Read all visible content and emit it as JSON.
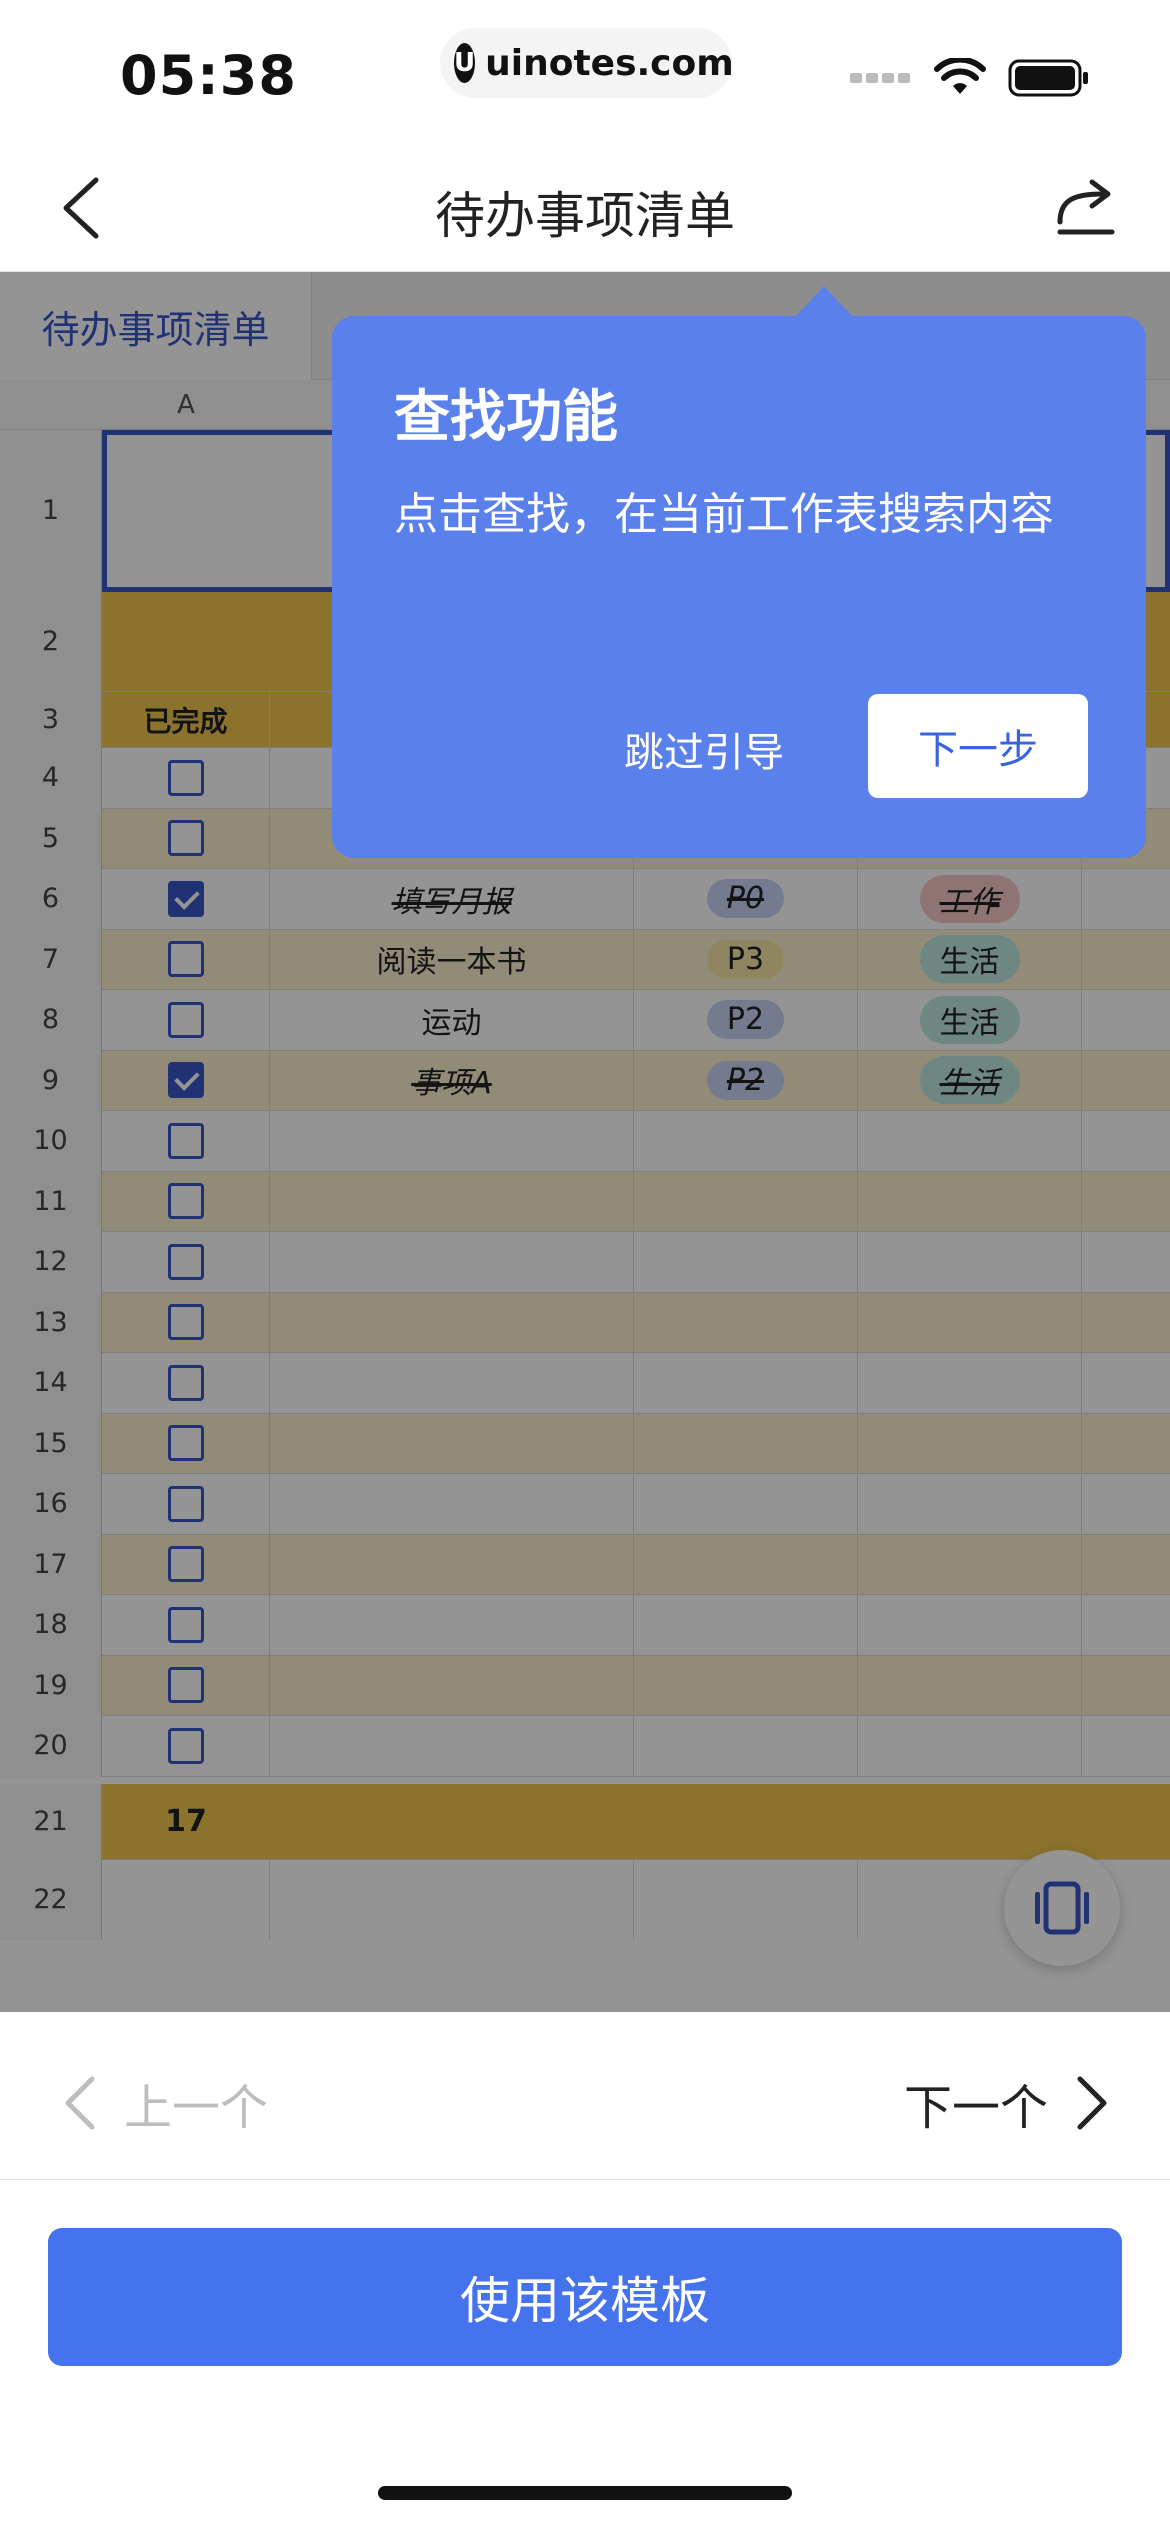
{
  "status": {
    "time": "05:38",
    "url": "uinotes.com",
    "url_logo": "U"
  },
  "nav": {
    "title": "待办事项清单"
  },
  "sheet": {
    "tab_name": "待办事项清单",
    "col_a": "A",
    "header_done": "已完成",
    "rows": [
      {
        "num": "4",
        "checked": false,
        "task": "",
        "priority": "",
        "category": ""
      },
      {
        "num": "5",
        "checked": false,
        "task": "",
        "priority": "",
        "category": ""
      },
      {
        "num": "6",
        "checked": true,
        "task": "填写月报",
        "priority": "P0",
        "category": "工作"
      },
      {
        "num": "7",
        "checked": false,
        "task": "阅读一本书",
        "priority": "P3",
        "category": "生活"
      },
      {
        "num": "8",
        "checked": false,
        "task": "运动",
        "priority": "P2",
        "category": "生活"
      },
      {
        "num": "9",
        "checked": true,
        "task": "事项A",
        "priority": "P2",
        "category": "生活"
      }
    ],
    "total_count": "17"
  },
  "tip": {
    "title": "查找功能",
    "desc": "点击查找，在当前工作表搜索内容",
    "skip": "跳过引导",
    "next": "下一步"
  },
  "pager": {
    "prev": "上一个",
    "next": "下一个"
  },
  "use_button": "使用该模板",
  "colors": {
    "accent": "#4573ee",
    "tip_bg": "#5a80ec",
    "row_tint": "#faf0cf",
    "header_gold": "#f1c74f"
  }
}
